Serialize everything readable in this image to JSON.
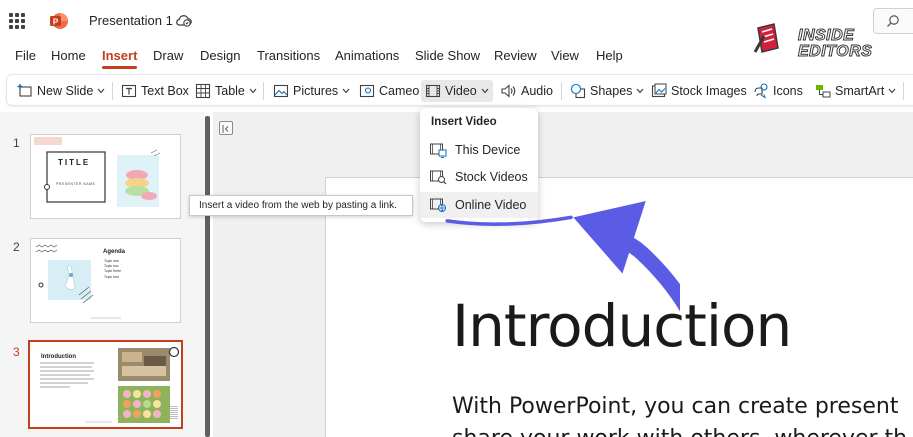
{
  "titlebar": {
    "doc_title": "Presentation 1",
    "logo_line1": "INSIDE",
    "logo_line2": "EDITORS"
  },
  "menu": {
    "tabs": [
      "File",
      "Home",
      "Insert",
      "Draw",
      "Design",
      "Transitions",
      "Animations",
      "Slide Show",
      "Review",
      "View",
      "Help"
    ],
    "active_tab": "Insert"
  },
  "ribbon": {
    "new_slide": "New Slide",
    "text_box": "Text Box",
    "table": "Table",
    "pictures": "Pictures",
    "cameo": "Cameo",
    "video": "Video",
    "audio": "Audio",
    "shapes": "Shapes",
    "stock_images": "Stock Images",
    "icons": "Icons",
    "smartart": "SmartArt"
  },
  "video_menu": {
    "header": "Insert Video",
    "items": [
      "This Device",
      "Stock Videos",
      "Online Video"
    ],
    "highlighted": "Online Video"
  },
  "tooltip": "Insert a video from the web by pasting a link.",
  "slides": [
    {
      "number": "1",
      "title": "TITLE",
      "subtitle": "PRESENTER NAME"
    },
    {
      "number": "2",
      "title": "Agenda",
      "lines": [
        "Topic one",
        "Topic two",
        "Topic three",
        "Topic four"
      ]
    },
    {
      "number": "3",
      "title": "Introduction",
      "active": true
    }
  ],
  "current_slide": {
    "title": "Introduction",
    "body_line1": "With PowerPoint, you can create present",
    "body_line2": "share your work with others, wherever th"
  },
  "colors": {
    "accent": "#c43e1c",
    "annotation_arrow": "#5b5ce6"
  }
}
